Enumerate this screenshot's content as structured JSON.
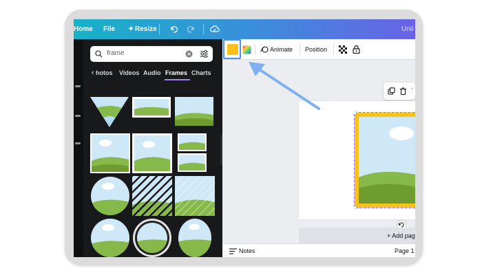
{
  "topbar": {
    "home_label": "Home",
    "file_label": "File",
    "resize_label": "Resize",
    "title_label": "Unti"
  },
  "search": {
    "value": "frame"
  },
  "tabs": [
    {
      "label": "Photos",
      "display": "hotos"
    },
    {
      "label": "Videos",
      "display": "Videos"
    },
    {
      "label": "Audio",
      "display": "Audio"
    },
    {
      "label": "Frames",
      "display": "Frames",
      "active": true
    },
    {
      "label": "Charts",
      "display": "Charts"
    }
  ],
  "toolbar": {
    "color_hex": "#f7c21c",
    "animate_label": "Animate",
    "position_label": "Position"
  },
  "canvas": {
    "add_page_label": "+ Add pag",
    "frame_color_hex": "#f7c21c"
  },
  "bottom": {
    "notes_label": "Notes",
    "page_label": "Page 1 /"
  },
  "colors": {
    "accent_blue": "#4a90e8",
    "tab_underline": "#a781f6",
    "sidebar_bg": "#18191b",
    "topbar_gradient_start": "#16b3c7",
    "topbar_gradient_end": "#6a62e6"
  },
  "icons": [
    "undo-icon",
    "redo-icon",
    "cloud-save-icon",
    "search-icon",
    "clear-search-icon",
    "filter-icon",
    "chevron-left-icon",
    "rainbow-color-icon",
    "animate-icon",
    "transparency-icon",
    "lock-icon",
    "duplicate-icon",
    "trash-icon",
    "rotate-icon",
    "notes-icon",
    "collapse-panel-icon",
    "pointer-arrow"
  ]
}
